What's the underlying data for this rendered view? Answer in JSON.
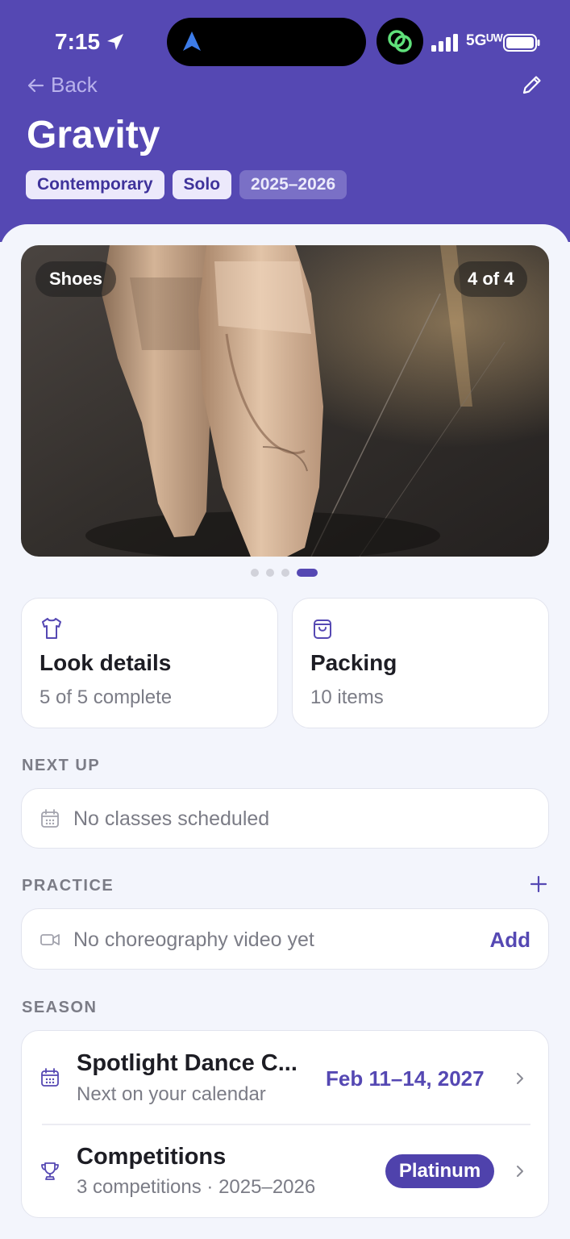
{
  "status_bar": {
    "time": "7:15",
    "network": "5Gᵁᵂ"
  },
  "header": {
    "back_label": "Back",
    "title": "Gravity",
    "tags": [
      "Contemporary",
      "Solo",
      "2025–2026"
    ]
  },
  "gallery": {
    "label": "Shoes",
    "counter": "4 of 4",
    "total": 4,
    "current": 4
  },
  "tiles": [
    {
      "title": "Look details",
      "subtitle": "5 of 5 complete",
      "icon": "shirt-icon"
    },
    {
      "title": "Packing",
      "subtitle": "10 items",
      "icon": "bag-icon"
    }
  ],
  "next_up": {
    "heading": "NEXT UP",
    "empty_text": "No classes scheduled"
  },
  "practice": {
    "heading": "PRACTICE",
    "empty_text": "No choreography video yet",
    "add_label": "Add"
  },
  "season": {
    "heading": "SEASON",
    "items": [
      {
        "title": "Spotlight Dance C...",
        "subtitle": "Next on your calendar",
        "value": "Feb 11–14, 2027",
        "icon": "calendar-icon"
      },
      {
        "title": "Competitions",
        "subtitle": "3 competitions · 2025–2026",
        "value": "Platinum",
        "icon": "trophy-icon"
      }
    ]
  },
  "colors": {
    "brand": "#5548b3",
    "background": "#f3f5fc",
    "muted_text": "#7b7c86"
  }
}
